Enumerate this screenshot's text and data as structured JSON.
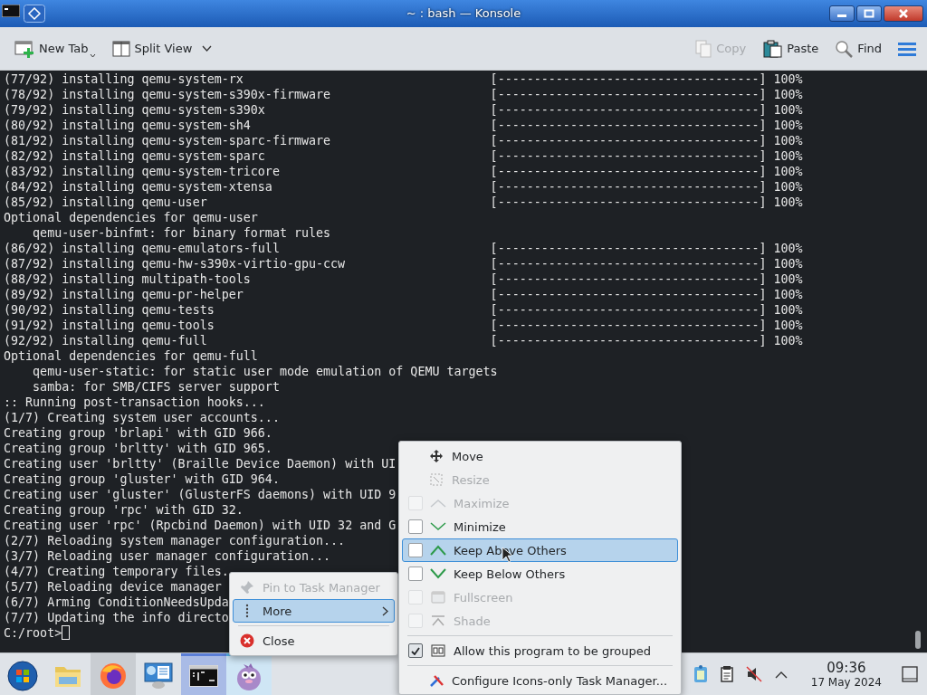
{
  "window": {
    "title": "~ : bash — Konsole"
  },
  "toolbar": {
    "left": [
      {
        "kind": "newtab",
        "label": "New Tab",
        "disabled": false
      },
      {
        "kind": "split",
        "label": "Split View",
        "disabled": false
      }
    ],
    "right": [
      {
        "kind": "copy",
        "label": "Copy",
        "disabled": true
      },
      {
        "kind": "paste",
        "label": "Paste",
        "disabled": false
      },
      {
        "kind": "find",
        "label": "Find",
        "disabled": false
      }
    ]
  },
  "terminal": {
    "lines": [
      {
        "kind": "progress",
        "text": "(77/92) installing qemu-system-rx",
        "bar": "[------------------------------------]",
        "percent": "100%"
      },
      {
        "kind": "progress",
        "text": "(78/92) installing qemu-system-s390x-firmware",
        "bar": "[------------------------------------]",
        "percent": "100%"
      },
      {
        "kind": "progress",
        "text": "(79/92) installing qemu-system-s390x",
        "bar": "[------------------------------------]",
        "percent": "100%"
      },
      {
        "kind": "progress",
        "text": "(80/92) installing qemu-system-sh4",
        "bar": "[------------------------------------]",
        "percent": "100%"
      },
      {
        "kind": "progress",
        "text": "(81/92) installing qemu-system-sparc-firmware",
        "bar": "[------------------------------------]",
        "percent": "100%"
      },
      {
        "kind": "progress",
        "text": "(82/92) installing qemu-system-sparc",
        "bar": "[------------------------------------]",
        "percent": "100%"
      },
      {
        "kind": "progress",
        "text": "(83/92) installing qemu-system-tricore",
        "bar": "[------------------------------------]",
        "percent": "100%"
      },
      {
        "kind": "progress",
        "text": "(84/92) installing qemu-system-xtensa",
        "bar": "[------------------------------------]",
        "percent": "100%"
      },
      {
        "kind": "progress",
        "text": "(85/92) installing qemu-user",
        "bar": "[------------------------------------]",
        "percent": "100%"
      },
      {
        "kind": "text",
        "text": "Optional dependencies for qemu-user"
      },
      {
        "kind": "text",
        "text": "    qemu-user-binfmt: for binary format rules"
      },
      {
        "kind": "progress",
        "text": "(86/92) installing qemu-emulators-full",
        "bar": "[------------------------------------]",
        "percent": "100%"
      },
      {
        "kind": "progress",
        "text": "(87/92) installing qemu-hw-s390x-virtio-gpu-ccw",
        "bar": "[------------------------------------]",
        "percent": "100%"
      },
      {
        "kind": "progress",
        "text": "(88/92) installing multipath-tools",
        "bar": "[------------------------------------]",
        "percent": "100%"
      },
      {
        "kind": "progress",
        "text": "(89/92) installing qemu-pr-helper",
        "bar": "[------------------------------------]",
        "percent": "100%"
      },
      {
        "kind": "progress",
        "text": "(90/92) installing qemu-tests",
        "bar": "[------------------------------------]",
        "percent": "100%"
      },
      {
        "kind": "progress",
        "text": "(91/92) installing qemu-tools",
        "bar": "[------------------------------------]",
        "percent": "100%"
      },
      {
        "kind": "progress",
        "text": "(92/92) installing qemu-full",
        "bar": "[------------------------------------]",
        "percent": "100%"
      },
      {
        "kind": "text",
        "text": "Optional dependencies for qemu-full"
      },
      {
        "kind": "text",
        "text": "    qemu-user-static: for static user mode emulation of QEMU targets"
      },
      {
        "kind": "text",
        "text": "    samba: for SMB/CIFS server support"
      },
      {
        "kind": "text",
        "text": ":: Running post-transaction hooks..."
      },
      {
        "kind": "text",
        "text": "(1/7) Creating system user accounts..."
      },
      {
        "kind": "text",
        "text": "Creating group 'brlapi' with GID 966."
      },
      {
        "kind": "text",
        "text": "Creating group 'brltty' with GID 965."
      },
      {
        "kind": "text",
        "text": "Creating user 'brltty' (Braille Device Daemon) with UI"
      },
      {
        "kind": "text",
        "text": "Creating group 'gluster' with GID 964."
      },
      {
        "kind": "text",
        "text": "Creating user 'gluster' (GlusterFS daemons) with UID 9"
      },
      {
        "kind": "text",
        "text": "Creating group 'rpc' with GID 32."
      },
      {
        "kind": "text",
        "text": "Creating user 'rpc' (Rpcbind Daemon) with UID 32 and G"
      },
      {
        "kind": "text",
        "text": "(2/7) Reloading system manager configuration..."
      },
      {
        "kind": "text",
        "text": "(3/7) Reloading user manager configuration..."
      },
      {
        "kind": "text",
        "text": "(4/7) Creating temporary files."
      },
      {
        "kind": "text",
        "text": "(5/7) Reloading device manager"
      },
      {
        "kind": "text",
        "text": "(6/7) Arming ConditionNeedsUpda"
      },
      {
        "kind": "text",
        "text": "(7/7) Updating the info directo"
      }
    ],
    "prompt": "C:/root>"
  },
  "context_menu": {
    "sections": [
      {
        "items": [
          {
            "kind": "pin",
            "label": "Pin to Task Manager",
            "disabled": true,
            "selected": false
          },
          {
            "kind": "more",
            "label": "More",
            "disabled": false,
            "selected": true
          }
        ]
      },
      {
        "items": [
          {
            "kind": "close",
            "label": "Close",
            "disabled": false,
            "selected": false
          }
        ]
      }
    ]
  },
  "submenu": {
    "sections": [
      {
        "items": [
          {
            "kind": "move",
            "label": "Move",
            "disabled": false,
            "selected": false
          },
          {
            "kind": "resize",
            "label": "Resize",
            "disabled": true,
            "selected": false
          },
          {
            "kind": "maximize",
            "label": "Maximize",
            "disabled": true,
            "selected": false,
            "checked": false
          },
          {
            "kind": "minimize",
            "label": "Minimize",
            "disabled": false,
            "selected": false,
            "checked": false
          },
          {
            "kind": "above",
            "label": "Keep Above Others",
            "disabled": false,
            "selected": true,
            "checked": false
          },
          {
            "kind": "below",
            "label": "Keep Below Others",
            "disabled": false,
            "selected": false,
            "checked": false
          },
          {
            "kind": "fullscreen",
            "label": "Fullscreen",
            "disabled": true,
            "selected": false,
            "checked": false
          },
          {
            "kind": "shade",
            "label": "Shade",
            "disabled": true,
            "selected": false,
            "checked": false
          }
        ]
      },
      {
        "items": [
          {
            "kind": "group",
            "label": "Allow this program to be grouped",
            "disabled": false,
            "selected": false,
            "checked": true
          }
        ]
      },
      {
        "items": [
          {
            "kind": "configure",
            "label": "Configure Icons-only Task Manager...",
            "disabled": false,
            "selected": false
          }
        ]
      }
    ]
  },
  "taskbar": {
    "tasks": [
      {
        "kind": "start",
        "pressed": false,
        "selected": false,
        "hovered": false
      },
      {
        "kind": "files",
        "pressed": false,
        "selected": false,
        "hovered": false
      },
      {
        "kind": "browser",
        "pressed": true,
        "selected": false,
        "hovered": false
      },
      {
        "kind": "settings",
        "pressed": false,
        "selected": false,
        "hovered": false
      },
      {
        "kind": "terminal",
        "pressed": false,
        "selected": true,
        "hovered": false
      },
      {
        "kind": "mascot",
        "pressed": false,
        "selected": false,
        "hovered": true
      }
    ],
    "tray": [
      {
        "kind": "clipboard"
      },
      {
        "kind": "notes"
      },
      {
        "kind": "muted"
      },
      {
        "kind": "expand"
      }
    ],
    "clock": {
      "time": "09:36",
      "date": "17 May 2024"
    }
  }
}
